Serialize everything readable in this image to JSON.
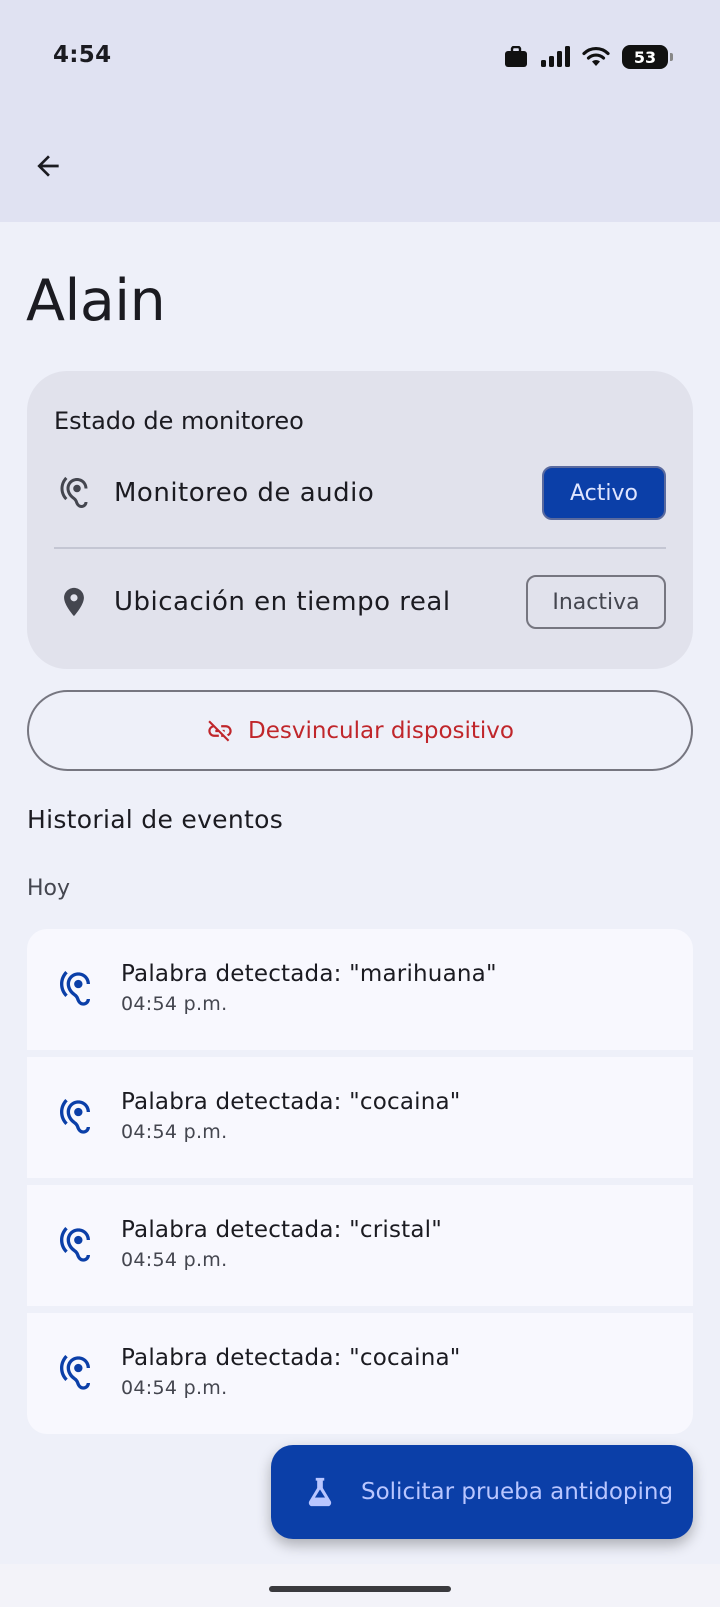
{
  "status_bar": {
    "time": "4:54",
    "battery": "53"
  },
  "app_bar": {
    "back_icon": "arrow-back-icon"
  },
  "page": {
    "title": "Alain"
  },
  "monitoring": {
    "title": "Estado de monitoreo",
    "audio": {
      "label": "Monitoreo de audio",
      "status": "Activo",
      "icon": "hearing-icon"
    },
    "location": {
      "label": "Ubicación en tiempo real",
      "status": "Inactiva",
      "icon": "location-pin-icon"
    }
  },
  "unlink_button": {
    "label": "Desvincular dispositivo",
    "icon": "link-off-icon",
    "color": "#c0262b"
  },
  "history": {
    "title": "Historial de eventos",
    "day": "Hoy",
    "events": [
      {
        "title": "Palabra detectada: \"marihuana\"",
        "time": "04:54 p.m."
      },
      {
        "title": "Palabra detectada: \"cocaina\"",
        "time": "04:54 p.m."
      },
      {
        "title": "Palabra detectada: \"cristal\"",
        "time": "04:54 p.m."
      },
      {
        "title": "Palabra detectada: \"cocaina\"",
        "time": "04:54 p.m."
      }
    ]
  },
  "fab": {
    "label": "Solicitar prueba antidoping",
    "icon": "flask-icon"
  },
  "colors": {
    "primary": "#0b3fa8",
    "error": "#c0262b",
    "surface": "#eef0f9",
    "card": "#e1e2ec"
  }
}
